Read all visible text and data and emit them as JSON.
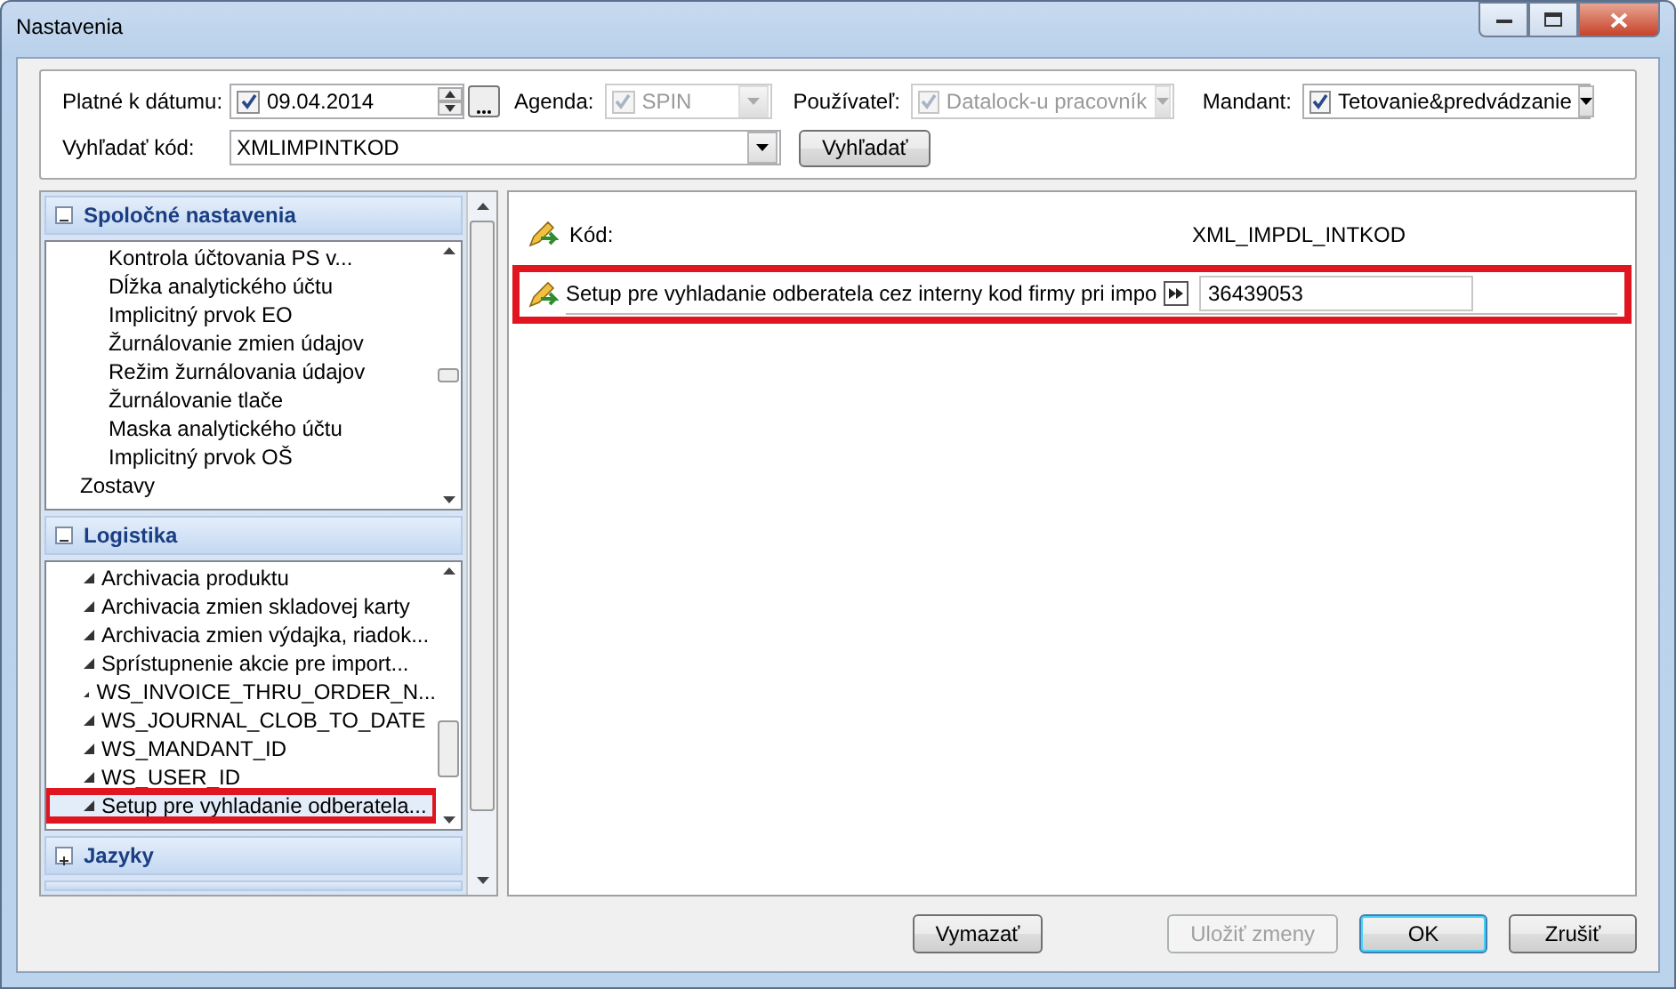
{
  "window": {
    "title": "Nastavenia"
  },
  "filters": {
    "date": {
      "label": "Platné k dátumu:",
      "checked": true,
      "value": "09.04.2014"
    },
    "agenda": {
      "label": "Agenda:",
      "checked": true,
      "value": "SPIN",
      "disabled": true
    },
    "user": {
      "label": "Používateľ:",
      "checked": true,
      "value": "Datalock-u pracovník",
      "disabled": true
    },
    "mandant": {
      "label": "Mandant:",
      "checked": true,
      "value": "Tetovanie&predvádzanie",
      "disabled": false
    },
    "search": {
      "label": "Vyhľadať kód:",
      "value": "XMLIMPINTKOD"
    },
    "search_button": "Vyhľadať"
  },
  "sections": [
    {
      "title": "Spoločné nastavenia",
      "expanded": true,
      "items": [
        {
          "label": "Kontrola účtovania PS v...",
          "kind": "entry",
          "selected": false,
          "highlighted": false
        },
        {
          "label": "Dĺžka analytického účtu",
          "kind": "entry",
          "selected": false,
          "highlighted": false
        },
        {
          "label": "Implicitný prvok EO",
          "kind": "entry",
          "selected": false,
          "highlighted": false
        },
        {
          "label": "Žurnálovanie zmien údajov",
          "kind": "entry",
          "selected": false,
          "highlighted": false
        },
        {
          "label": "Režim žurnálovania údajov",
          "kind": "entry",
          "selected": false,
          "highlighted": false
        },
        {
          "label": "Žurnálovanie tlače",
          "kind": "entry",
          "selected": false,
          "highlighted": false
        },
        {
          "label": "Maska analytického účtu",
          "kind": "entry",
          "selected": false,
          "highlighted": false
        },
        {
          "label": "Implicitný prvok OŠ",
          "kind": "entry",
          "selected": false,
          "highlighted": false
        },
        {
          "label": "Zostavy",
          "kind": "group",
          "selected": false,
          "highlighted": false
        }
      ]
    },
    {
      "title": "Logistika",
      "expanded": true,
      "items": [
        {
          "label": "Archivacia produktu",
          "kind": "marked",
          "selected": false,
          "highlighted": false
        },
        {
          "label": "Archivacia zmien skladovej karty",
          "kind": "marked",
          "selected": false,
          "highlighted": false
        },
        {
          "label": "Archivacia zmien výdajka, riadok...",
          "kind": "marked",
          "selected": false,
          "highlighted": false
        },
        {
          "label": "Sprístupnenie akcie pre import...",
          "kind": "marked",
          "selected": false,
          "highlighted": false
        },
        {
          "label": "WS_INVOICE_THRU_ORDER_N...",
          "kind": "marked",
          "selected": false,
          "highlighted": false
        },
        {
          "label": "WS_JOURNAL_CLOB_TO_DATE",
          "kind": "marked",
          "selected": false,
          "highlighted": false
        },
        {
          "label": "WS_MANDANT_ID",
          "kind": "marked",
          "selected": false,
          "highlighted": false
        },
        {
          "label": "WS_USER_ID",
          "kind": "marked",
          "selected": false,
          "highlighted": false
        },
        {
          "label": "Setup pre vyhladanie odberatela...",
          "kind": "marked",
          "selected": true,
          "highlighted": true
        }
      ]
    },
    {
      "title": "Jazyky",
      "expanded": false
    }
  ],
  "settings": [
    {
      "label": "Kód:",
      "value": "XML_IMPDL_INTKOD",
      "kind": "readonly",
      "highlighted": false
    },
    {
      "label": "Setup pre vyhladanie odberatela cez interny kod firmy pri impo",
      "value": "36439053",
      "kind": "editable",
      "highlighted": true
    }
  ],
  "buttons": [
    {
      "label": "Vymazať",
      "disabled": false,
      "default": false
    },
    {
      "label": "Uložiť zmeny",
      "disabled": true,
      "default": false
    },
    {
      "label": "OK",
      "disabled": false,
      "default": true
    },
    {
      "label": "Zrušiť",
      "disabled": false,
      "default": false
    }
  ]
}
